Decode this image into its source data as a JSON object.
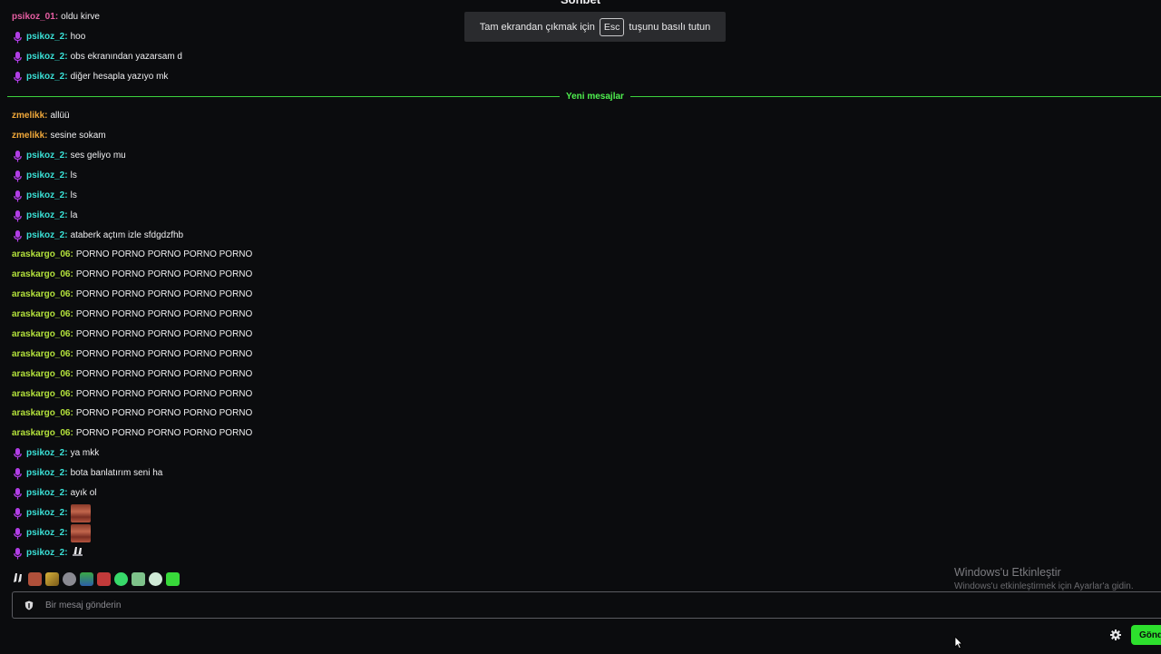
{
  "chat_header": {
    "title": "Sohbet"
  },
  "fullscreen_toast": {
    "prefix": "Tam ekrandan çıkmak için",
    "key": "Esc",
    "suffix": "tuşunu basılı tutun"
  },
  "divider": {
    "label": "Yeni mesajlar"
  },
  "messages": [
    {
      "user": "psikoz_01",
      "text": "oldu kirve"
    },
    {
      "user": "psikoz_2",
      "text": "hoo"
    },
    {
      "user": "psikoz_2",
      "text": "obs ekranından yazarsam d"
    },
    {
      "user": "psikoz_2",
      "text": "diğer hesapla yazıyo mk"
    },
    {
      "user": "zmelikk",
      "text": "allüü"
    },
    {
      "user": "zmelikk",
      "text": "sesine sokam"
    },
    {
      "user": "psikoz_2",
      "text": "ses geliyo mu"
    },
    {
      "user": "psikoz_2",
      "text": "ls"
    },
    {
      "user": "psikoz_2",
      "text": "ls"
    },
    {
      "user": "psikoz_2",
      "text": "la"
    },
    {
      "user": "psikoz_2",
      "text": "ataberk açtım izle sfdgdzfhb"
    },
    {
      "user": "araskargo_06",
      "text": "PORNO PORNO PORNO PORNO PORNO"
    },
    {
      "user": "araskargo_06",
      "text": "PORNO PORNO PORNO PORNO PORNO"
    },
    {
      "user": "araskargo_06",
      "text": "PORNO PORNO PORNO PORNO PORNO"
    },
    {
      "user": "araskargo_06",
      "text": "PORNO PORNO PORNO PORNO PORNO"
    },
    {
      "user": "araskargo_06",
      "text": "PORNO PORNO PORNO PORNO PORNO"
    },
    {
      "user": "araskargo_06",
      "text": "PORNO PORNO PORNO PORNO PORNO"
    },
    {
      "user": "araskargo_06",
      "text": "PORNO PORNO PORNO PORNO PORNO"
    },
    {
      "user": "araskargo_06",
      "text": "PORNO PORNO PORNO PORNO PORNO"
    },
    {
      "user": "araskargo_06",
      "text": "PORNO PORNO PORNO PORNO PORNO"
    },
    {
      "user": "araskargo_06",
      "text": "PORNO PORNO PORNO PORNO PORNO"
    },
    {
      "user": "psikoz_2",
      "text": "ya mkk"
    },
    {
      "user": "psikoz_2",
      "text": "bota banlatırım seni ha"
    },
    {
      "user": "psikoz_2",
      "text": "ayık ol"
    },
    {
      "user": "psikoz_2",
      "text": ""
    },
    {
      "user": "psikoz_2",
      "text": ""
    },
    {
      "user": "psikoz_2",
      "text": ""
    }
  ],
  "input": {
    "placeholder": "Bir mesaj gönderin"
  },
  "send_button": {
    "label": "Gönder"
  },
  "windows_activation": {
    "title": "Windows'u Etkinleştir",
    "subtitle": "Windows'u etkinleştirmek için Ayarlar'a gidin."
  },
  "colors": {
    "pink": "#e75ea3",
    "cyan": "#3ae0d6",
    "orange": "#f0a83a",
    "lime": "#b4e23c",
    "accent_green": "#2de02d"
  }
}
